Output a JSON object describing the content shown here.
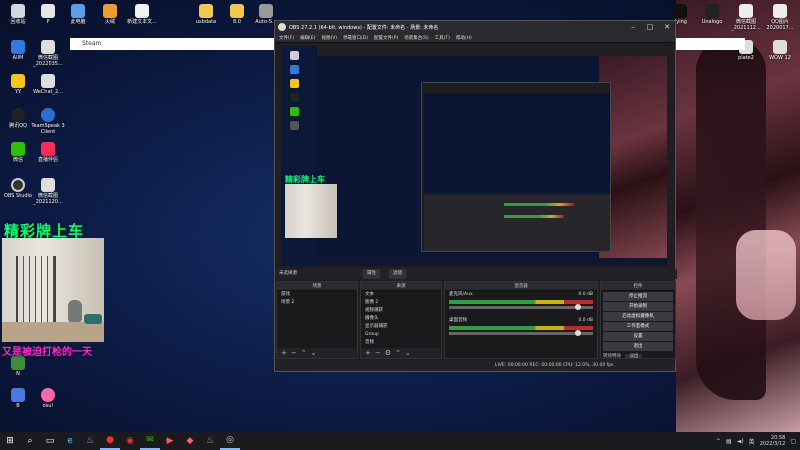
{
  "desktop": {
    "top_icons": [
      {
        "label": "回收站"
      },
      {
        "label": "P"
      },
      {
        "label": "此电脑"
      },
      {
        "label": "火绒"
      },
      {
        "label": "新建文本文..."
      },
      {
        "label": "usbdata"
      },
      {
        "label": "8.0"
      },
      {
        "label": "Auto-S..."
      }
    ],
    "left_icons": [
      {
        "label": "AIIM"
      },
      {
        "label": "微信截图_2022035..."
      },
      {
        "label": "YY"
      },
      {
        "label": "WeChat_2..."
      },
      {
        "label": "腾讯QQ"
      },
      {
        "label": "TeamSpeak 3 Client"
      },
      {
        "label": "微信"
      },
      {
        "label": "直播伴侣"
      },
      {
        "label": "OBS Studio"
      },
      {
        "label": "微信截图_2021120..."
      },
      {
        "label": "N"
      },
      {
        "label": "B"
      },
      {
        "label": "osu!"
      }
    ],
    "right_icons": [
      {
        "label": "Unalogo"
      },
      {
        "label": "微信截图_2021112..."
      },
      {
        "label": "QQ图片2020017..."
      },
      {
        "label": "dying"
      },
      {
        "label": "plate2"
      },
      {
        "label": "WOW 12"
      }
    ],
    "steam_bar_label": "Steam",
    "cam_overlay_title": "精彩牌上车",
    "cam_overlay_caption": "又是被迫打枪的一天"
  },
  "obs": {
    "title": "OBS 27.2.1 (64-bit, windows) - 配置文件: 未命名 - 场景: 未命名",
    "controls": {
      "minimize": "–",
      "maximize": "□",
      "close": "✕"
    },
    "menu": [
      "文件(F)",
      "编辑(E)",
      "视图(V)",
      "停靠窗口(D)",
      "配置文件(P)",
      "场景集合(S)",
      "工具(T)",
      "帮助(H)"
    ],
    "preview_status": "未选择源",
    "preview_buttons": [
      "属性",
      "滤镜"
    ],
    "scenes": {
      "title": "场景",
      "items": [
        {
          "label": "游戏"
        },
        {
          "label": "场景 2"
        }
      ]
    },
    "sources": {
      "title": "来源",
      "items": [
        {
          "label": "文本"
        },
        {
          "label": "图像 2"
        },
        {
          "label": "视频捕获"
        },
        {
          "label": "摄像头"
        },
        {
          "label": "显示器捕获"
        },
        {
          "label": "Group"
        },
        {
          "label": "音频"
        }
      ]
    },
    "mixer": {
      "title": "混音器",
      "channels": [
        {
          "name": "麦克风/Aux",
          "db": "0.0 dB",
          "level": 0.62,
          "volume": 0.95
        },
        {
          "name": "桌面音频",
          "db": "0.0 dB",
          "level": 0.55,
          "volume": 0.95
        }
      ]
    },
    "controls_dock": {
      "title": "控件",
      "buttons": [
        "停止推流",
        "开始录制",
        "启动虚拟摄像机",
        "工作室模式",
        "设置",
        "退出"
      ],
      "transition_label": "转场特效",
      "transition_value": "淡出"
    },
    "status_bar": "LIVE: 00:00:00   REC: 00:00:00   CPU: 12.0%, 30.00 fps"
  },
  "taskbar": {
    "icons": [
      {
        "name": "start-icon",
        "glyph": "⊞"
      },
      {
        "name": "search-icon",
        "glyph": "⌕"
      },
      {
        "name": "task-view-icon",
        "glyph": "▭"
      },
      {
        "name": "edge-icon",
        "glyph": "e"
      },
      {
        "name": "steam-icon",
        "glyph": "♨"
      },
      {
        "name": "recorder-icon",
        "glyph": "●"
      },
      {
        "name": "netease-icon",
        "glyph": "◉"
      },
      {
        "name": "wechat-icon",
        "glyph": "✉"
      },
      {
        "name": "media-icon",
        "glyph": "▶"
      },
      {
        "name": "game-icon",
        "glyph": "◆"
      },
      {
        "name": "steam2-icon",
        "glyph": "♨"
      },
      {
        "name": "obs-icon",
        "glyph": "◎"
      }
    ],
    "tray_lang": "英",
    "time": "20:58",
    "date": "2022/3/12"
  },
  "colors": {
    "cam_title": "#00ff77",
    "cam_caption": "#ff2bd1",
    "obs_bg": "#1f1e22",
    "desktop_bg": "#0d1d48"
  }
}
